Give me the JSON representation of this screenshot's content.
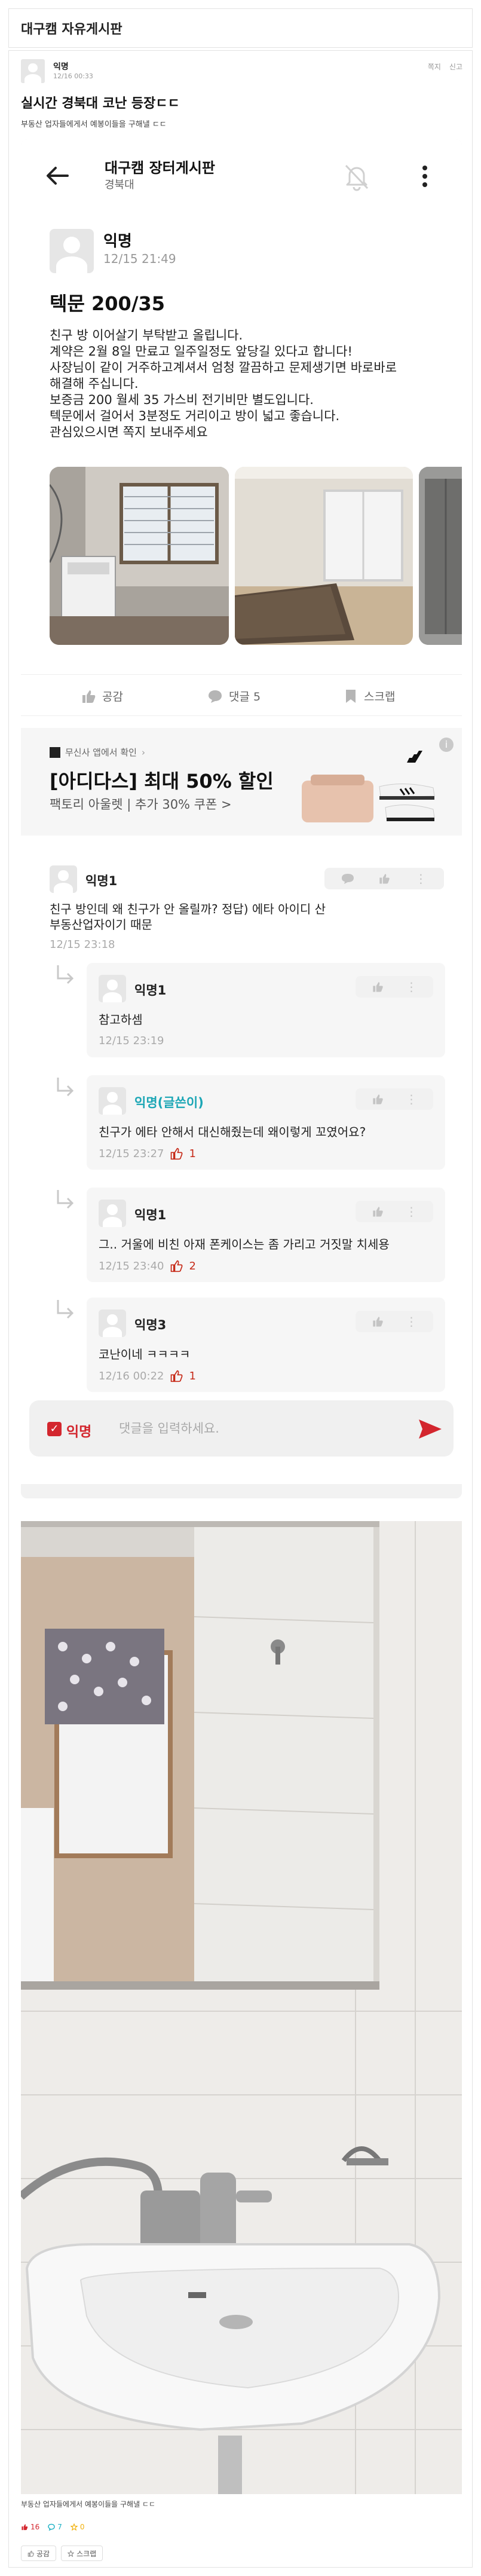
{
  "board": {
    "title": "대구캠 자유게시판"
  },
  "post": {
    "author": "익명",
    "time": "12/16 00:33",
    "message_label": "쪽지",
    "report_label": "신고",
    "title": "실시간 경북대 코난 등장ㄷㄷ",
    "subtitle": "부동산 업자들에게서 예봉이들을 구해낼 ㄷㄷ",
    "caption": "부동산 업자들에게서 예봉이들을 구해낼 ㄷㄷ",
    "stats": {
      "likes": "16",
      "comments": "7",
      "scraps": "0"
    },
    "buttons": {
      "like": "공감",
      "scrap": "스크랩"
    },
    "colors": {
      "accent": "#d3262e",
      "like": "#d3262e",
      "comment": "#1bb1c4",
      "scrap": "#f2b20d"
    }
  },
  "embedded": {
    "board_title": "대구캠 장터게시판",
    "board_sub": "경북대",
    "author": "익명",
    "time": "12/15 21:49",
    "title": "텍문 200/35",
    "body_lines": [
      "친구 방 이어살기 부탁받고 올립니다.",
      "계약은 2월 8일 만료고 일주일정도 앞당길 있다고 합니다!",
      "사장님이 같이 거주하고계셔서 엄청 깔끔하고 문제생기면 바로바로",
      "해결해 주십니다.",
      "보증금 200 월세 35 가스비 전기비만 별도입니다.",
      "텍문에서 걸어서 3분정도 거리이고 방이 넓고 좋습니다.",
      "관심있으시면 쪽지 보내주세요"
    ],
    "actions": {
      "like": "공감",
      "comment": "댓글 5",
      "scrap": "스크랩"
    },
    "ad": {
      "sponsor": "무신사 앱에서 확인",
      "title": "[아디다스] 최대 50% 할인",
      "desc": "팩토리 아울렛 | 추가 30% 쿠폰 >",
      "info": "i"
    },
    "comments": [
      {
        "name": "익명1",
        "text_lines": [
          "친구 방인데 왜 친구가 안 올릴까? 정답) 에타 아이디 산",
          "부동산업자이기 때문"
        ],
        "time": "12/15 23:18",
        "likes": ""
      }
    ],
    "replies": [
      {
        "name": "익명1",
        "text": "참고하셈",
        "time": "12/15 23:19",
        "likes": "",
        "name_color": "#222222"
      },
      {
        "name": "익명(글쓴이)",
        "text": "친구가 에타 안해서 대신해줬는데 왜이렇게 꼬였어요?",
        "time": "12/15 23:27",
        "likes": "1",
        "name_color": "#1ba6b5"
      },
      {
        "name": "익명1",
        "text": "그.. 거울에 비친 아재 폰케이스는 좀 가리고 거짓말 치세용",
        "time": "12/15 23:40",
        "likes": "2",
        "name_color": "#222222"
      },
      {
        "name": "익명3",
        "text": "코난이네 ㅋㅋㅋㅋ",
        "time": "12/16 00:22",
        "likes": "1",
        "name_color": "#222222"
      }
    ],
    "input": {
      "anon_label": "익명",
      "placeholder": "댓글을 입력하세요."
    }
  }
}
